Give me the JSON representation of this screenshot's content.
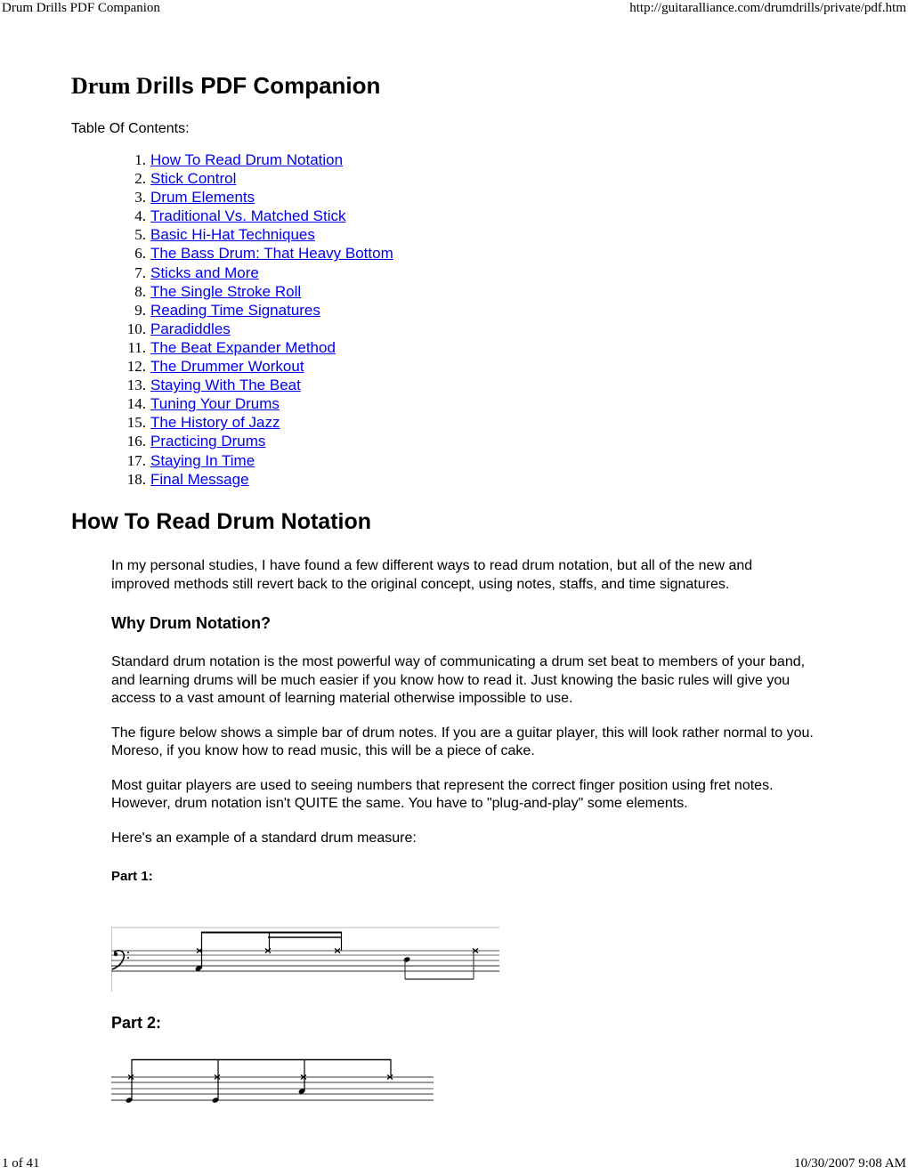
{
  "print_header": {
    "page_title": "Drum Drills PDF Companion",
    "url": "http://guitaralliance.com/drumdrills/private/pdf.htm"
  },
  "print_footer": {
    "page_count": "1 of 41",
    "timestamp": "10/30/2007 9:08 AM"
  },
  "document": {
    "title_part1": "Drum D",
    "title_part2": "rills PDF Companion",
    "toc_label": "Table Of Contents:",
    "toc": [
      {
        "num": "1.",
        "label": "How To Read Drum Notation"
      },
      {
        "num": "2.",
        "label": "Stick Control"
      },
      {
        "num": "3.",
        "label": "Drum Elements"
      },
      {
        "num": "4.",
        "label": "Traditional Vs. Matched Stick"
      },
      {
        "num": "5.",
        "label": "Basic Hi-Hat Techniques"
      },
      {
        "num": "6.",
        "label": "The Bass Drum: That Heavy Bottom"
      },
      {
        "num": "7.",
        "label": "Sticks and More"
      },
      {
        "num": "8.",
        "label": "The Single Stroke Roll"
      },
      {
        "num": "9.",
        "label": "Reading Time Signatures"
      },
      {
        "num": "10.",
        "label": "Paradiddles"
      },
      {
        "num": "11.",
        "label": "The Beat Expander Method"
      },
      {
        "num": "12.",
        "label": "The Drummer Workout"
      },
      {
        "num": "13.",
        "label": "Staying With The Beat"
      },
      {
        "num": "14.",
        "label": "Tuning Your Drums"
      },
      {
        "num": "15.",
        "label": "The History of Jazz"
      },
      {
        "num": "16.",
        "label": "Practicing Drums"
      },
      {
        "num": "17.",
        "label": "Staying In Time"
      },
      {
        "num": "18.",
        "label": "Final Message"
      }
    ],
    "link_color": "#0000ee"
  },
  "section": {
    "heading": "How To Read Drum Notation",
    "intro": "In my personal studies, I have found a few different ways to read drum notation, but all of the new and improved methods still revert back to the original concept, using notes, staffs, and time signatures.",
    "subheading": "Why Drum Notation?",
    "paragraphs": [
      "Standard drum notation is the most powerful way of communicating a drum set beat to members of your band, and learning drums will be much easier if you know how to read it. Just knowing the basic rules will give you access to a vast amount of learning material otherwise impossible to use.",
      "The figure below shows a simple bar of drum notes. If you are a guitar player, this will look rather normal to you. Moreso, if you know how to read music, this will be a piece of cake.",
      "Most guitar players are used to seeing numbers that represent the correct finger position using fret notes. However, drum notation isn't QUITE the same. You have to \"plug-and-play\" some elements.",
      "Here's an example of a standard drum measure:"
    ],
    "part1_label": "Part 1:",
    "part2_label": "Part 2:"
  },
  "figures": {
    "part1": {
      "clef": "bass",
      "clef_glyph": "𝄢",
      "notes": [
        {
          "type": "hihat-x",
          "with_kick": true
        },
        {
          "type": "hihat-x"
        },
        {
          "type": "hihat-x"
        },
        {
          "type": "snare",
          "stem": "down"
        },
        {
          "type": "hihat-x",
          "stem": "down"
        }
      ]
    },
    "part2": {
      "notes": [
        {
          "type": "hihat-x",
          "with_kick": true
        },
        {
          "type": "hihat-x",
          "with_kick": true
        },
        {
          "type": "hihat-x",
          "with_snare": true
        },
        {
          "type": "hihat-x"
        }
      ]
    }
  }
}
